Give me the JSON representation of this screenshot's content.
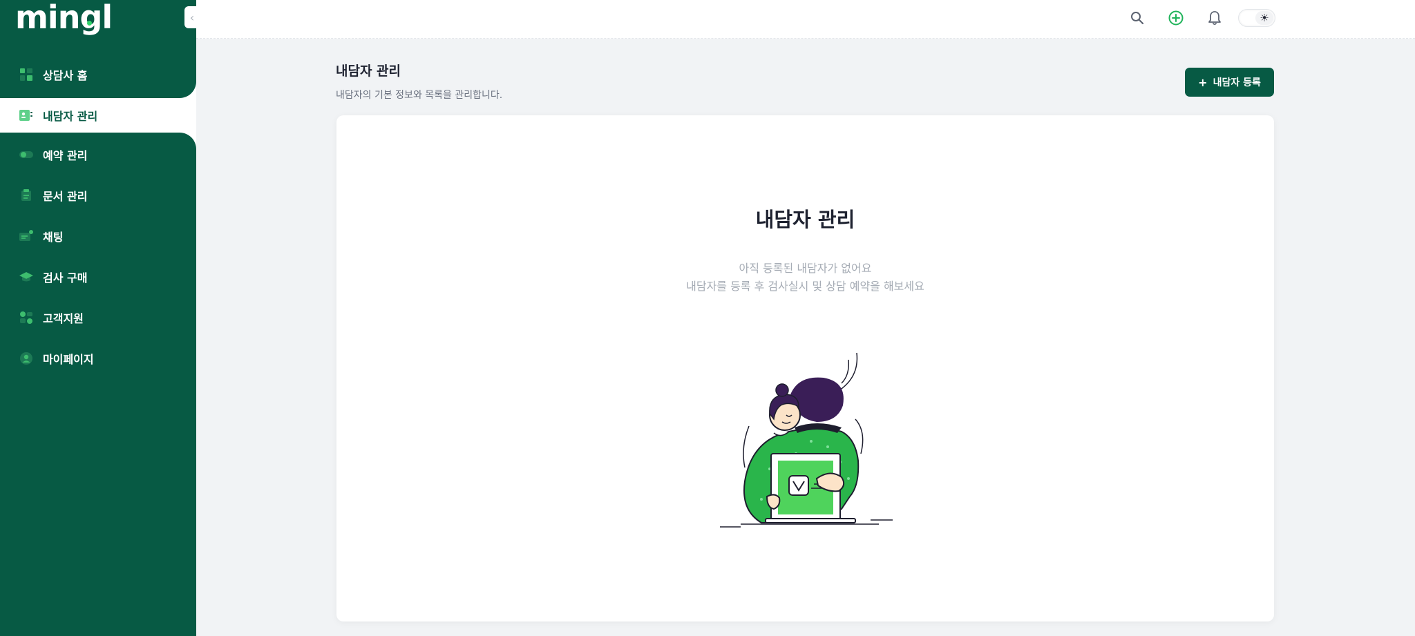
{
  "app": {
    "logo": "mingl"
  },
  "sidebar": {
    "items": [
      {
        "label": "상담사 홈",
        "icon": "dashboard-icon"
      },
      {
        "label": "내담자 관리",
        "icon": "client-card-icon",
        "active": true
      },
      {
        "label": "예약 관리",
        "icon": "toggle-icon"
      },
      {
        "label": "문서 관리",
        "icon": "document-icon"
      },
      {
        "label": "채팅",
        "icon": "chat-icon"
      },
      {
        "label": "검사 구매",
        "icon": "graduation-cap-icon"
      },
      {
        "label": "고객지원",
        "icon": "support-icon"
      },
      {
        "label": "마이페이지",
        "icon": "user-icon"
      }
    ],
    "collapse_glyph": "‹"
  },
  "header": {
    "icons": [
      "search-icon",
      "add-circle-icon",
      "bell-icon",
      "theme-toggle"
    ],
    "theme_glyph": "☀"
  },
  "page": {
    "title": "내담자 관리",
    "subtitle": "내담자의 기본 정보와 목록을 관리합니다.",
    "register_button": {
      "plus": "+",
      "label": "내담자 등록"
    }
  },
  "empty_state": {
    "title": "내담자 관리",
    "line1": "아직 등록된 내담자가 없어요",
    "line2": "내담자를 등록 후 검사실시 및 상담 예약을 해보세요"
  },
  "colors": {
    "brand": "#075a44",
    "accent": "#1fb35a",
    "illustration_green": "#2ab54b"
  }
}
